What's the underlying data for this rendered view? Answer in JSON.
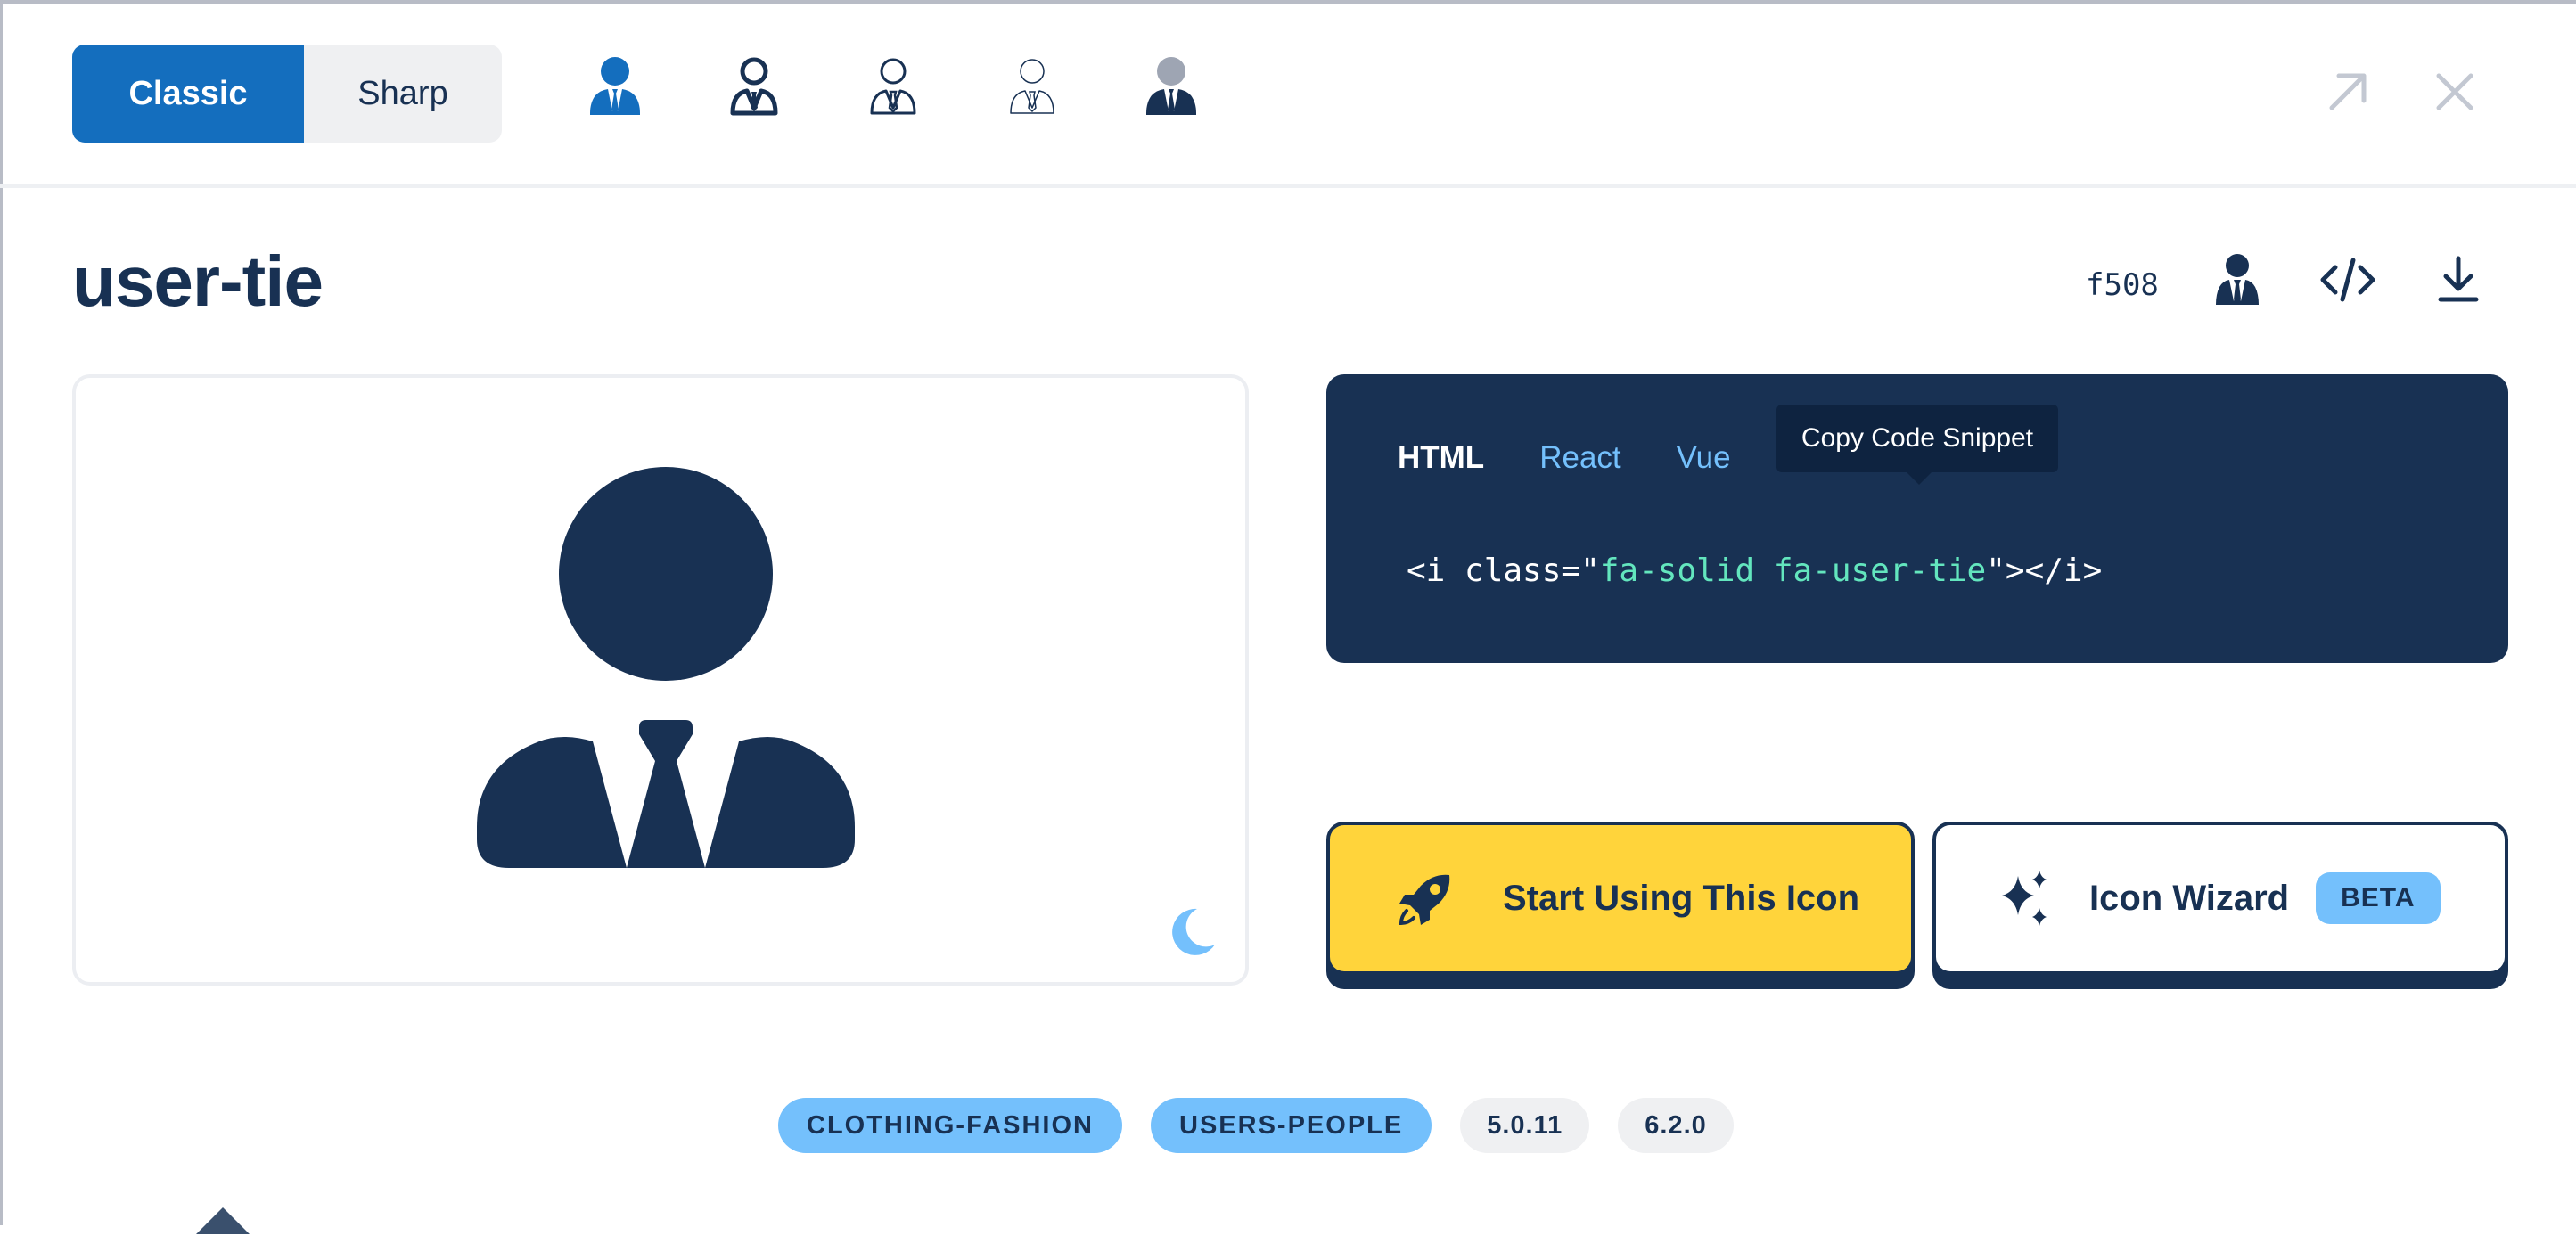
{
  "header": {
    "family_toggle": {
      "classic": "Classic",
      "sharp": "Sharp"
    },
    "style_icons": [
      "solid-icon",
      "regular-icon",
      "light-icon",
      "thin-icon",
      "duotone-icon"
    ],
    "expand_icon": "arrow-up-right-icon",
    "close_icon": "close-icon"
  },
  "icon": {
    "name": "user-tie",
    "unicode": "f508"
  },
  "toolbar_icons": [
    "user-tie-glyph-icon",
    "code-icon",
    "download-icon"
  ],
  "code_panel": {
    "tabs": [
      "HTML",
      "React",
      "Vue"
    ],
    "active_tab": "HTML",
    "tooltip": "Copy Code Snippet",
    "snippet_prefix": "<i class=\"",
    "snippet_class": "fa-solid fa-user-tie",
    "snippet_suffix": "\"></i>"
  },
  "actions": {
    "start": "Start Using This Icon",
    "wizard": "Icon Wizard",
    "beta": "BETA"
  },
  "tags": {
    "categories": [
      "CLOTHING-FASHION",
      "USERS-PEOPLE"
    ],
    "versions": [
      "5.0.11",
      "6.2.0"
    ]
  },
  "colors": {
    "brand_blue": "#146ebe",
    "navy": "#183153",
    "yellow": "#ffd43b",
    "light_blue": "#74c0fc",
    "mint": "#63e6be"
  }
}
